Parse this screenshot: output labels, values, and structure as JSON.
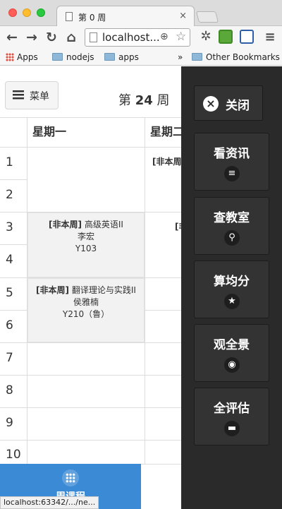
{
  "browser": {
    "tab_title": "第 0 周",
    "tab_close": "×",
    "url": "localhost...",
    "bookmarks": [
      "Apps",
      "nodejs",
      "apps",
      "»",
      "Other Bookmarks"
    ],
    "nav_icons": [
      "back-icon",
      "forward-icon",
      "reload-icon",
      "home-icon"
    ],
    "status_url": "localhost:63342/.../ne..."
  },
  "header": {
    "menu_label": "菜单",
    "week_prefix": "第",
    "week_number": "24",
    "week_suffix": "周"
  },
  "timetable": {
    "days": [
      "星期一",
      "星期二"
    ],
    "periods": [
      "1",
      "2",
      "3",
      "4",
      "5",
      "6",
      "7",
      "8",
      "9",
      "10"
    ],
    "courses": [
      {
        "nonweek_tag": "[非本周]",
        "name": "高级英语II",
        "teacher": "李宏",
        "room": "Y103"
      },
      {
        "nonweek_tag": "[非本周]",
        "name": "翻译理论与实践II",
        "teacher": "侯雅楠",
        "room": "Y210（鲁）"
      }
    ],
    "partial_tue_1": "[非本周",
    "partial_tue_3": "[非"
  },
  "bottom_nav": {
    "label": "周课程",
    "icon": "grid-icon"
  },
  "drawer": {
    "close_label": "关闭",
    "close_icon": "×",
    "items": [
      {
        "label": "看资讯",
        "icon": "≡"
      },
      {
        "label": "查教室",
        "icon": "⚲"
      },
      {
        "label": "算均分",
        "icon": "★"
      },
      {
        "label": "观全景",
        "icon": "◉"
      },
      {
        "label": "全评估",
        "icon": "▬"
      }
    ]
  },
  "colors": {
    "drawer_bg": "#2a2a2a",
    "drawer_button": "#333333",
    "bottom_tab": "#3a8ad6",
    "course_bg": "#f2f2f2"
  }
}
